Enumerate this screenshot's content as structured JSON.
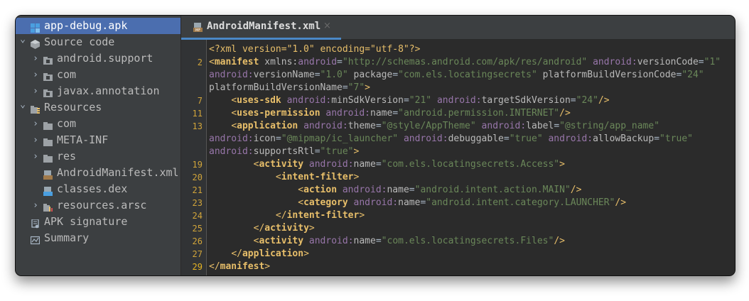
{
  "sidebar": {
    "items": [
      {
        "label": "app-debug.apk",
        "icon": "apk-icon",
        "arrow": "",
        "indent": 0,
        "selected": true
      },
      {
        "label": "Source code",
        "icon": "source-code-icon",
        "arrow": "⌄",
        "indent": 0
      },
      {
        "label": "android.support",
        "icon": "package-folder-icon",
        "arrow": "›",
        "indent": 1
      },
      {
        "label": "com",
        "icon": "package-folder-icon",
        "arrow": "›",
        "indent": 1
      },
      {
        "label": "javax.annotation",
        "icon": "package-folder-icon",
        "arrow": "›",
        "indent": 1
      },
      {
        "label": "Resources",
        "icon": "resources-icon",
        "arrow": "⌄",
        "indent": 0
      },
      {
        "label": "com",
        "icon": "folder-icon",
        "arrow": "›",
        "indent": 1
      },
      {
        "label": "META-INF",
        "icon": "folder-icon",
        "arrow": "›",
        "indent": 1
      },
      {
        "label": "res",
        "icon": "folder-icon",
        "arrow": "›",
        "indent": 1
      },
      {
        "label": "AndroidManifest.xml",
        "icon": "manifest-file-icon",
        "arrow": "",
        "indent": 1
      },
      {
        "label": "classes.dex",
        "icon": "dex-file-icon",
        "arrow": "",
        "indent": 1
      },
      {
        "label": "resources.arsc",
        "icon": "arsc-file-icon",
        "arrow": "›",
        "indent": 1
      },
      {
        "label": "APK signature",
        "icon": "certificate-icon",
        "arrow": "",
        "indent": 0
      },
      {
        "label": "Summary",
        "icon": "summary-icon",
        "arrow": "",
        "indent": 0
      }
    ]
  },
  "editor": {
    "tab": {
      "label": "AndroidManifest.xml",
      "close": "×",
      "icon": "manifest-file-icon"
    },
    "colors": {
      "tag": "#e8bf6a",
      "attr": "#bababa",
      "namespace": "#9876aa",
      "value": "#6a8759",
      "line_number": "#d0a43a"
    },
    "lines": [
      {
        "num": "",
        "tokens": [
          [
            "pi",
            "<?xml version=\"1.0\" encoding=\"utf-8\"?>"
          ]
        ]
      },
      {
        "num": "2",
        "tokens": [
          [
            "tag",
            "<"
          ],
          [
            "tn",
            "manifest "
          ],
          [
            "an",
            "xmlns:"
          ],
          [
            "ans",
            "android"
          ],
          [
            "txt",
            "="
          ],
          [
            "av",
            "\"http://schemas.android.com/apk/res/android\" "
          ],
          [
            "ans",
            "android:"
          ],
          [
            "an",
            "versionCode"
          ],
          [
            "txt",
            "="
          ],
          [
            "av",
            "\"1\""
          ]
        ]
      },
      {
        "num": "",
        "tokens": [
          [
            "ans",
            "android:"
          ],
          [
            "an",
            "versionName"
          ],
          [
            "txt",
            "="
          ],
          [
            "av",
            "\"1.0\" "
          ],
          [
            "an",
            "package"
          ],
          [
            "txt",
            "="
          ],
          [
            "av",
            "\"com.els.locatingsecrets\" "
          ],
          [
            "an",
            "platformBuildVersionCode"
          ],
          [
            "txt",
            "="
          ],
          [
            "av",
            "\"24\""
          ]
        ]
      },
      {
        "num": "",
        "tokens": [
          [
            "an",
            "platformBuildVersionName"
          ],
          [
            "txt",
            "="
          ],
          [
            "av",
            "\"7\""
          ],
          [
            "tag",
            ">"
          ]
        ]
      },
      {
        "num": "7",
        "tokens": [
          [
            "txt",
            "    "
          ],
          [
            "tag",
            "<"
          ],
          [
            "tn",
            "uses-sdk "
          ],
          [
            "ans",
            "android:"
          ],
          [
            "an",
            "minSdkVersion"
          ],
          [
            "txt",
            "="
          ],
          [
            "av",
            "\"21\" "
          ],
          [
            "ans",
            "android:"
          ],
          [
            "an",
            "targetSdkVersion"
          ],
          [
            "txt",
            "="
          ],
          [
            "av",
            "\"24\""
          ],
          [
            "tag",
            "/>"
          ]
        ]
      },
      {
        "num": "11",
        "tokens": [
          [
            "txt",
            "    "
          ],
          [
            "tag",
            "<"
          ],
          [
            "tn",
            "uses-permission "
          ],
          [
            "ans",
            "android:"
          ],
          [
            "an",
            "name"
          ],
          [
            "txt",
            "="
          ],
          [
            "av",
            "\"android.permission.INTERNET\""
          ],
          [
            "tag",
            "/>"
          ]
        ]
      },
      {
        "num": "13",
        "tokens": [
          [
            "txt",
            "    "
          ],
          [
            "tag",
            "<"
          ],
          [
            "tn",
            "application "
          ],
          [
            "ans",
            "android:"
          ],
          [
            "an",
            "theme"
          ],
          [
            "txt",
            "="
          ],
          [
            "av",
            "\"@style/AppTheme\" "
          ],
          [
            "ans",
            "android:"
          ],
          [
            "an",
            "label"
          ],
          [
            "txt",
            "="
          ],
          [
            "av",
            "\"@string/app_name\""
          ]
        ]
      },
      {
        "num": "",
        "tokens": [
          [
            "ans",
            "android:"
          ],
          [
            "an",
            "icon"
          ],
          [
            "txt",
            "="
          ],
          [
            "av",
            "\"@mipmap/ic_launcher\" "
          ],
          [
            "ans",
            "android:"
          ],
          [
            "an",
            "debuggable"
          ],
          [
            "txt",
            "="
          ],
          [
            "av",
            "\"true\" "
          ],
          [
            "ans",
            "android:"
          ],
          [
            "an",
            "allowBackup"
          ],
          [
            "txt",
            "="
          ],
          [
            "av",
            "\"true\""
          ]
        ]
      },
      {
        "num": "",
        "tokens": [
          [
            "ans",
            "android:"
          ],
          [
            "an",
            "supportsRtl"
          ],
          [
            "txt",
            "="
          ],
          [
            "av",
            "\"true\""
          ],
          [
            "tag",
            ">"
          ]
        ]
      },
      {
        "num": "19",
        "tokens": [
          [
            "txt",
            "        "
          ],
          [
            "tag",
            "<"
          ],
          [
            "tn",
            "activity "
          ],
          [
            "ans",
            "android:"
          ],
          [
            "an",
            "name"
          ],
          [
            "txt",
            "="
          ],
          [
            "av",
            "\"com.els.locatingsecrets.Access\""
          ],
          [
            "tag",
            ">"
          ]
        ]
      },
      {
        "num": "20",
        "tokens": [
          [
            "txt",
            "            "
          ],
          [
            "tag",
            "<"
          ],
          [
            "tn",
            "intent-filter"
          ],
          [
            "tag",
            ">"
          ]
        ]
      },
      {
        "num": "21",
        "tokens": [
          [
            "txt",
            "                "
          ],
          [
            "tag",
            "<"
          ],
          [
            "tn",
            "action "
          ],
          [
            "ans",
            "android:"
          ],
          [
            "an",
            "name"
          ],
          [
            "txt",
            "="
          ],
          [
            "av",
            "\"android.intent.action.MAIN\""
          ],
          [
            "tag",
            "/>"
          ]
        ]
      },
      {
        "num": "23",
        "tokens": [
          [
            "txt",
            "                "
          ],
          [
            "tag",
            "<"
          ],
          [
            "tn",
            "category "
          ],
          [
            "ans",
            "android:"
          ],
          [
            "an",
            "name"
          ],
          [
            "txt",
            "="
          ],
          [
            "av",
            "\"android.intent.category.LAUNCHER\""
          ],
          [
            "tag",
            "/>"
          ]
        ]
      },
      {
        "num": "24",
        "tokens": [
          [
            "txt",
            "            "
          ],
          [
            "tag",
            "</"
          ],
          [
            "tn",
            "intent-filter"
          ],
          [
            "tag",
            ">"
          ]
        ]
      },
      {
        "num": "25",
        "tokens": [
          [
            "txt",
            "        "
          ],
          [
            "tag",
            "</"
          ],
          [
            "tn",
            "activity"
          ],
          [
            "tag",
            ">"
          ]
        ]
      },
      {
        "num": "26",
        "tokens": [
          [
            "txt",
            "        "
          ],
          [
            "tag",
            "<"
          ],
          [
            "tn",
            "activity "
          ],
          [
            "ans",
            "android:"
          ],
          [
            "an",
            "name"
          ],
          [
            "txt",
            "="
          ],
          [
            "av",
            "\"com.els.locatingsecrets.Files\""
          ],
          [
            "tag",
            "/>"
          ]
        ]
      },
      {
        "num": "27",
        "tokens": [
          [
            "txt",
            "    "
          ],
          [
            "tag",
            "</"
          ],
          [
            "tn",
            "application"
          ],
          [
            "tag",
            ">"
          ]
        ]
      },
      {
        "num": "29",
        "tokens": [
          [
            "tag",
            "</"
          ],
          [
            "tn",
            "manifest"
          ],
          [
            "tag",
            ">"
          ]
        ]
      }
    ]
  }
}
